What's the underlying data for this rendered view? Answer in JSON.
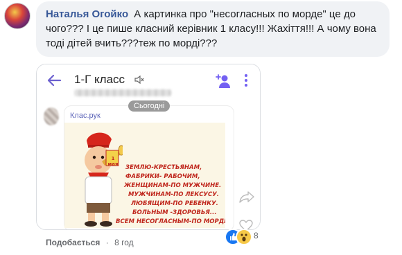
{
  "comment": {
    "author": "Наталья Огойко",
    "text": "А картинка про \"несогласных по морде\" це до чого??? І це пише класний керівник 1 класу!!! Жахіття!!! А чому вона тоді дітей вчить???теж по морді???"
  },
  "screenshot": {
    "chat_title": "1-Г класс",
    "date_label": "Сьогодні",
    "sender": "Клас.рук",
    "poster": {
      "badge_text": "1 мая",
      "lines": [
        "ЗЕМЛЮ-КРЕСТЬЯНАМ,",
        "ФАБРИКИ- РАБОЧИМ,",
        "ЖЕНЩИНАМ-ПО МУЖЧИНЕ.",
        "МУЖЧИНАМ-ПО ЛЕКСУСУ.",
        "ЛЮБЯЩИМ-ПО РЕБЕНКУ.",
        "БОЛЬНЫМ -ЗДОРОВЬЯ...",
        "ВСЕМ НЕСОГЛАСНЫМ-ПО МОРДЕ!"
      ]
    },
    "heart_count": "0"
  },
  "actions": {
    "like_label": "Подобається",
    "separator": "·",
    "time": "8 год"
  },
  "reactions": {
    "count": "8",
    "types": [
      "like-icon",
      "wow-icon"
    ]
  },
  "colors": {
    "author": "#385898",
    "bubble": "#f0f2f5",
    "like_blue": "#1877f2",
    "viber_purple": "#7360f2"
  }
}
